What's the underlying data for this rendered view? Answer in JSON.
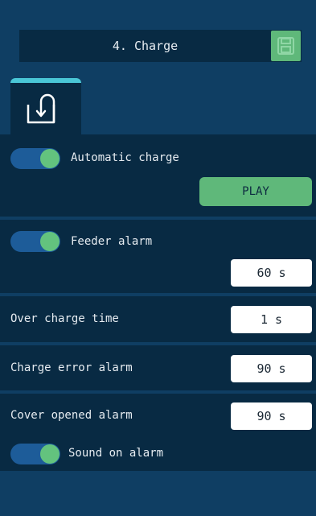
{
  "header": {
    "title": "4. Charge",
    "save_icon": "floppy-disk-icon"
  },
  "tab": {
    "icon": "charge-return-icon",
    "accent": "#4ac6d6"
  },
  "automatic_charge": {
    "label": "Automatic charge",
    "enabled": true,
    "play_label": "PLAY"
  },
  "feeder_alarm": {
    "label": "Feeder alarm",
    "enabled": true,
    "value": "60 s"
  },
  "over_charge_time": {
    "label": "Over charge time",
    "value": "1 s"
  },
  "charge_error_alarm": {
    "label": "Charge error alarm",
    "value": "90 s"
  },
  "cover_opened_alarm": {
    "label": "Cover opened alarm",
    "value": "90 s"
  },
  "sound_on_alarm": {
    "label": "Sound on alarm",
    "enabled": true
  },
  "colors": {
    "background": "#0f3e63",
    "panel": "#082a43",
    "accent_green": "#5fb87a",
    "toggle_track": "#1d5c99"
  }
}
